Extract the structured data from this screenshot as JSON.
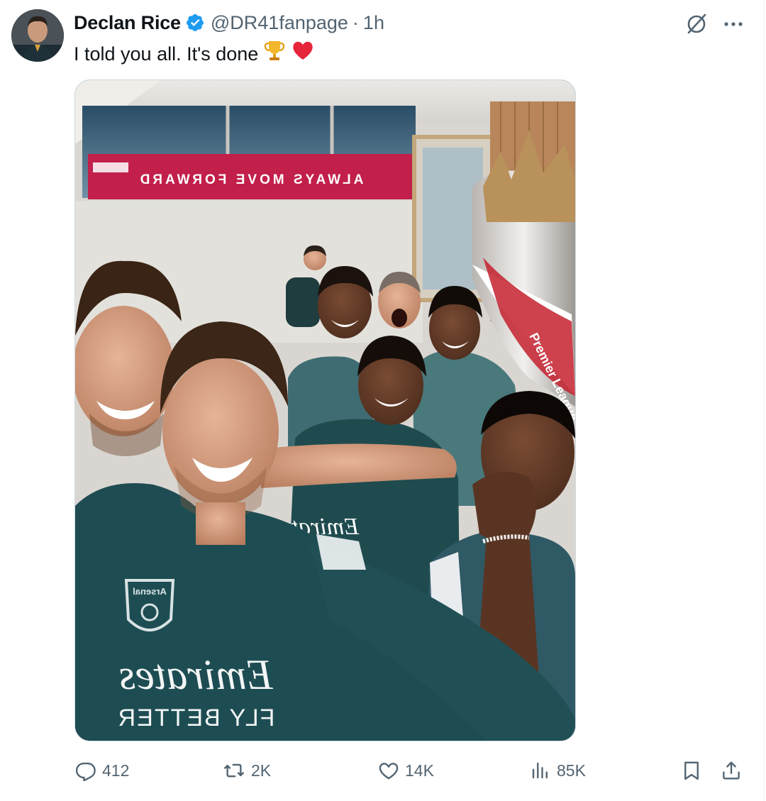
{
  "tweet": {
    "author": {
      "name": "Declan Rice",
      "handle": "@DR41fanpage",
      "verified": true,
      "avatar_icon": "avatar-photo"
    },
    "time": "1h",
    "separator": "·",
    "text": "I told you all. It's done",
    "emojis": [
      "trophy-emoji",
      "red-heart-emoji"
    ],
    "media": {
      "kind": "photo",
      "banner_text": "ALWAYS MOVE FORWARD",
      "trophy_ribbon_text": "Premier League",
      "shirt_sponsor": "Emirates",
      "shirt_sponsor_tagline": "FLY BETTER",
      "crest_text": "Arsenal"
    },
    "actions": {
      "reply": {
        "icon": "reply-icon",
        "count": "412"
      },
      "retweet": {
        "icon": "retweet-icon",
        "count": "2K"
      },
      "like": {
        "icon": "heart-icon",
        "count": "14K"
      },
      "views": {
        "icon": "views-icon",
        "count": "85K"
      },
      "bookmark": {
        "icon": "bookmark-icon"
      },
      "share": {
        "icon": "share-icon"
      }
    }
  },
  "colors": {
    "verified_blue": "#1d9bf0",
    "text": "#0f1419",
    "secondary": "#536471",
    "banner": "#c21f4b"
  }
}
